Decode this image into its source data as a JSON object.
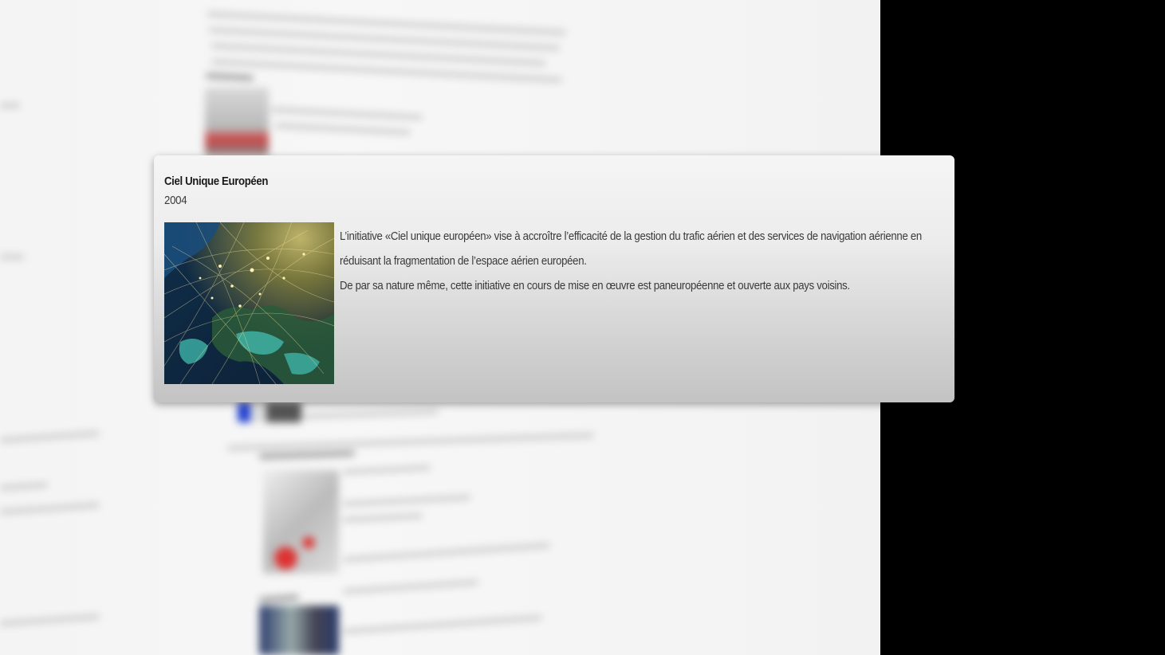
{
  "popup": {
    "title": "Ciel Unique Européen",
    "year": "2004",
    "image_alt": "Europe at night with air traffic routes",
    "paragraph_1": "L’initiative «Ciel unique européen» vise à accroître l’efficacité de la gestion du trafic aérien et des services de navigation aérienne en réduisant la fragmentation de l’espace aérien européen.",
    "paragraph_2": "De par sa nature même, cette initiative en cours de mise en œuvre est paneuropéenne et ouverte aux pays voisins."
  },
  "colors": {
    "card_top": "#f5f5f5",
    "card_bottom": "#c3c3c3",
    "title_text": "#1a1a1a",
    "body_text": "#3a3a3a",
    "backdrop": "#000000"
  }
}
